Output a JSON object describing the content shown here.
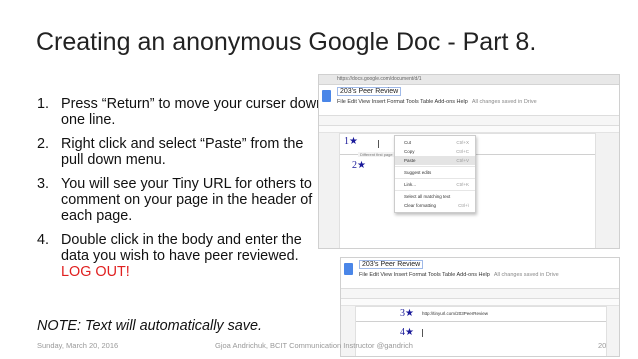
{
  "slide": {
    "title": "Creating an anonymous Google Doc - Part 8.",
    "steps": [
      {
        "num": "1.",
        "text": "Press “Return” to move your curser down one line."
      },
      {
        "num": "2.",
        "text": "Right click and select “Paste” from the pull down menu."
      },
      {
        "num": "3.",
        "text": "You will see your Tiny URL for others to comment on your page in the header of each page."
      },
      {
        "num": "4.",
        "text": "Double click in the body and enter the data you wish to have peer reviewed. ",
        "emphasis": "LOG OUT!"
      }
    ],
    "note": "NOTE: Text will automatically save.",
    "footer": {
      "date": "Sunday, March 20, 2016",
      "credit": "Gjoa Andrichuk, BCIT Communication Instructor @gandrich",
      "page": "20"
    }
  },
  "screenshot1": {
    "url": "https://docs.google.com/document/d/1",
    "doc_title": "203's Peer Review",
    "menus": "File  Edit  View  Insert  Format  Tools  Table  Add-ons  Help",
    "saved_status": "All changes saved in Drive",
    "header_label": "Different first page header",
    "star1": "1★",
    "star2": "2★",
    "context_menu": [
      {
        "label": "Cut",
        "shortcut": "Ctrl+X"
      },
      {
        "label": "Copy",
        "shortcut": "Ctrl+C"
      },
      {
        "label": "Paste",
        "shortcut": "Ctrl+V"
      },
      {
        "label": "Suggest edits",
        "shortcut": ""
      },
      {
        "label": "Link...",
        "shortcut": "Ctrl+K"
      },
      {
        "label": "Select all matching text",
        "shortcut": ""
      },
      {
        "label": "Clear formatting",
        "shortcut": "Ctrl+\\"
      }
    ]
  },
  "screenshot2": {
    "doc_title": "203's Peer Review",
    "menus": "File  Edit  View  Insert  Format  Tools  Table  Add-ons  Help",
    "saved_status": "All changes saved in Drive",
    "pasted_url": "http://tinyurl.com/203PeerReview",
    "star3": "3★",
    "star4": "4★"
  }
}
